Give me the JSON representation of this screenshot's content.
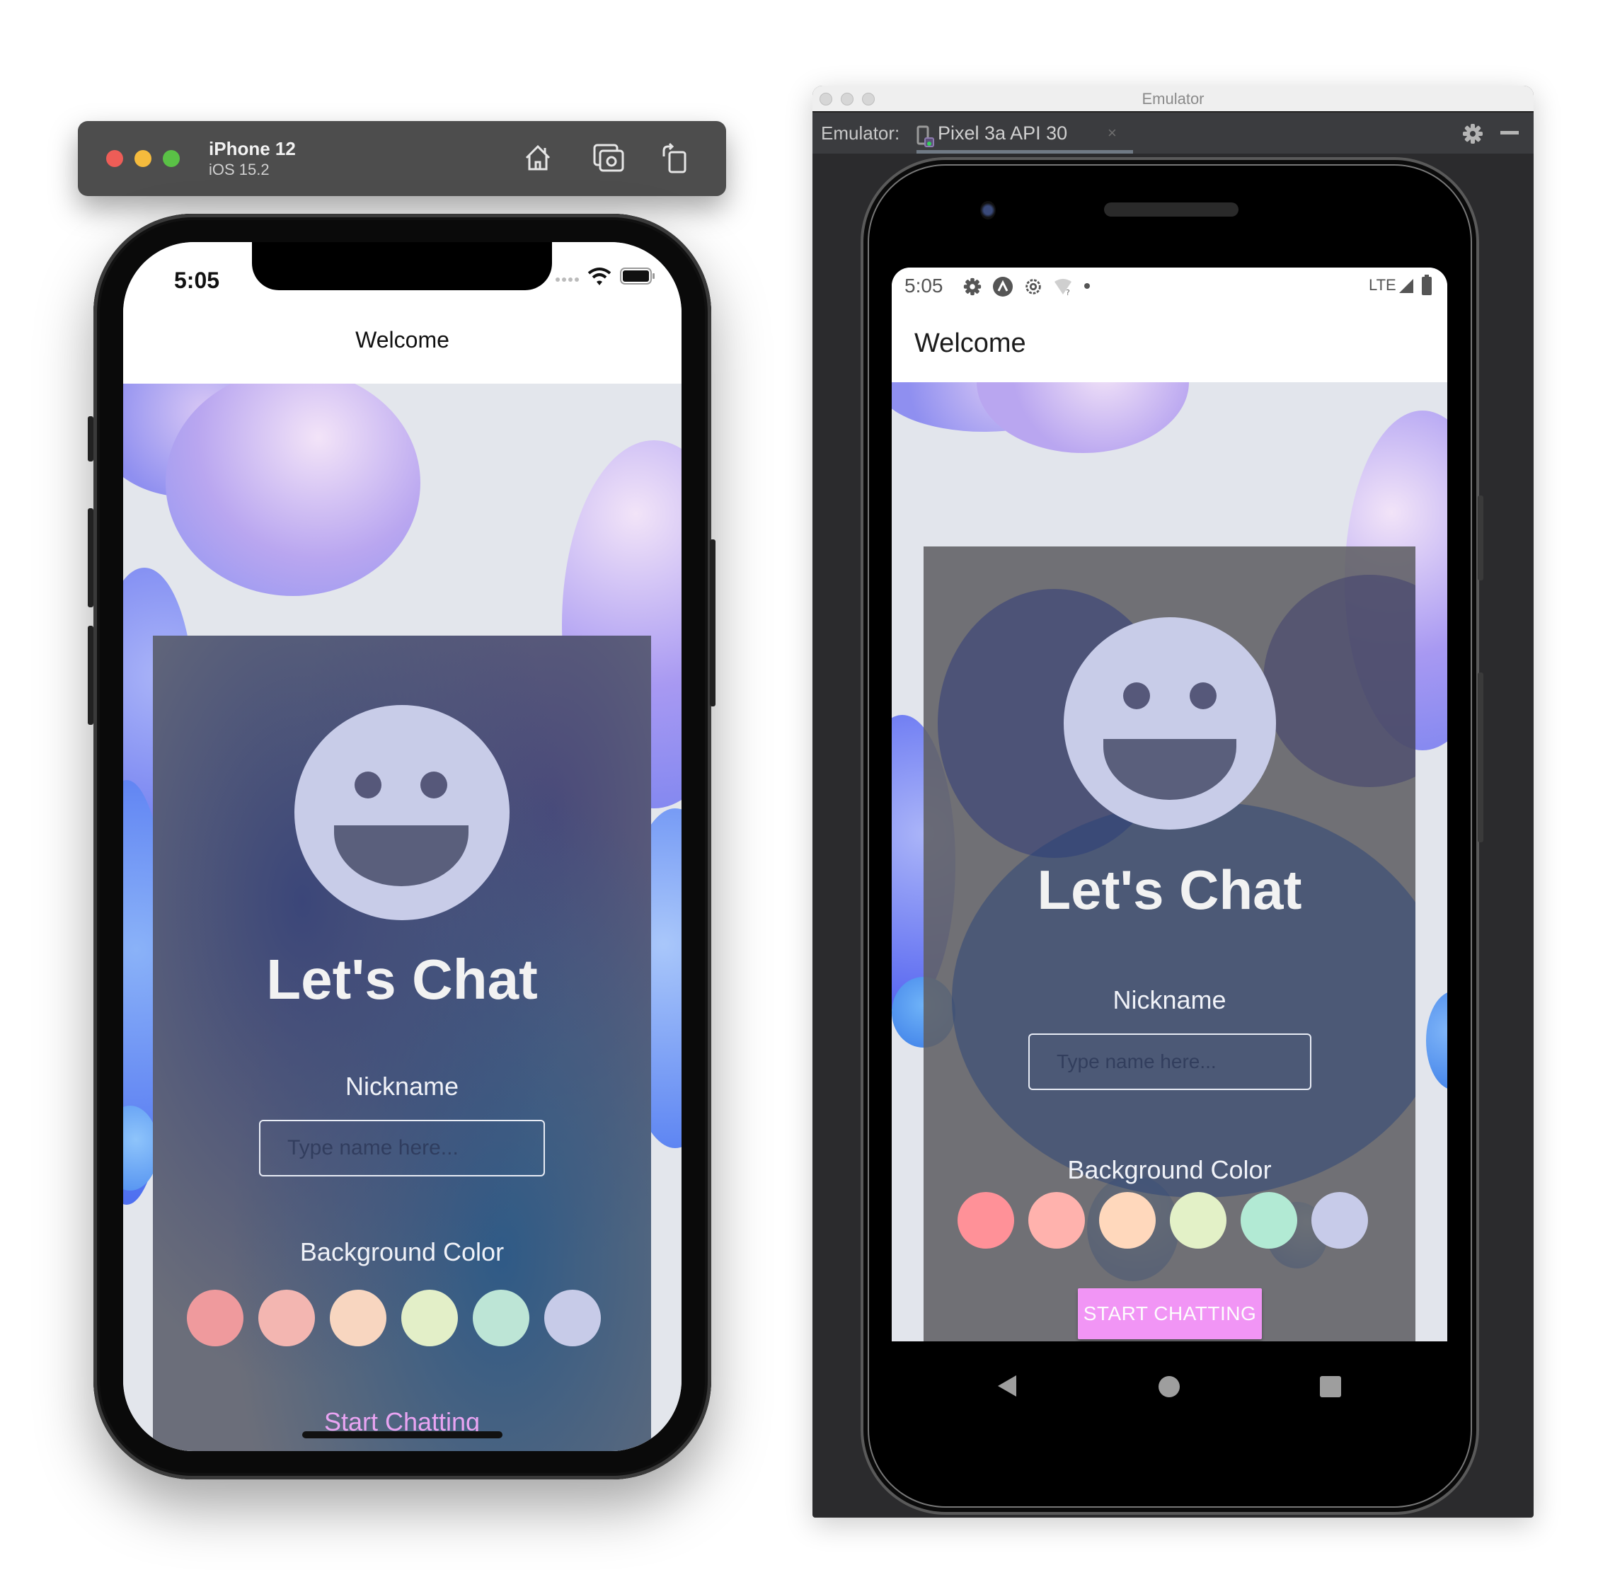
{
  "ios_simulator": {
    "device_name": "iPhone 12",
    "os_version": "iOS 15.2",
    "toolbar_icons": [
      "home-icon",
      "screenshot-icon",
      "rotate-icon"
    ],
    "traffic_lights": {
      "close": "#ee5d57",
      "minimize": "#f5bb3d",
      "maximize": "#5ac146"
    },
    "status_bar": {
      "time": "5:05",
      "icons": [
        "signal-dots-icon",
        "wifi-icon",
        "battery-icon"
      ]
    },
    "nav_title": "Welcome",
    "app": {
      "title": "Let's Chat",
      "nickname_label": "Nickname",
      "nickname_placeholder": "Type name here...",
      "nickname_value": "",
      "background_label": "Background Color",
      "start_button": "Start Chatting",
      "start_button_color": "#e9a4f2"
    }
  },
  "android_emulator": {
    "window_title": "Emulator",
    "tab_prefix": "Emulator:",
    "tab_name": "Pixel 3a API 30",
    "tab_close": "×",
    "status_bar": {
      "time": "5:05",
      "left_icons": [
        "settings-icon",
        "app-notification-icon",
        "settings-outline-icon",
        "wifi-unknown-icon",
        "dot-icon"
      ],
      "network": "LTE",
      "right_icons": [
        "signal-icon",
        "battery-icon"
      ]
    },
    "appbar_title": "Welcome",
    "app": {
      "title": "Let's Chat",
      "nickname_label": "Nickname",
      "nickname_placeholder": "Type name here...",
      "nickname_value": "",
      "background_label": "Background Color",
      "start_button": "START CHATTING",
      "start_button_color": "#f195f5"
    },
    "nav_buttons": [
      "back-icon",
      "home-icon",
      "recents-icon"
    ]
  },
  "color_options": {
    "ios": [
      "#ef9a9d",
      "#f3b6b1",
      "#f8d6c0",
      "#e3efc8",
      "#bde5d6",
      "#c7cbe8"
    ],
    "android": [
      "#ff9198",
      "#ffb2ad",
      "#ffd8bc",
      "#e3f1c7",
      "#b2ead4",
      "#c7cbe9"
    ]
  },
  "smiley_color": "#c8cce8"
}
